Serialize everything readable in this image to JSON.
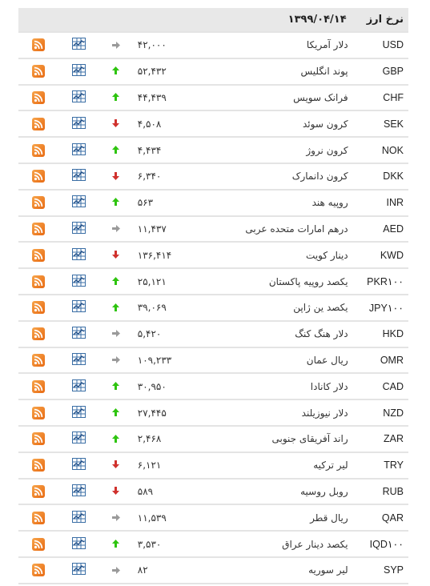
{
  "header": {
    "title": "نرخ ارز",
    "date": "۱۳۹۹/۰۴/۱۴"
  },
  "colors": {
    "up": "#2ec40f",
    "down": "#d0312d",
    "flat": "#9a9a9a",
    "rss": "#f08a2c",
    "chart": "#3a6ea5",
    "header_bg": "#e8e8e8"
  },
  "rows": [
    {
      "code": "USD",
      "name": "دلار آمریکا",
      "value": "۴۲,۰۰۰",
      "trend": "flat"
    },
    {
      "code": "GBP",
      "name": "پوند انگلیس",
      "value": "۵۲,۴۳۲",
      "trend": "up"
    },
    {
      "code": "CHF",
      "name": "فرانک سویس",
      "value": "۴۴,۴۳۹",
      "trend": "up"
    },
    {
      "code": "SEK",
      "name": "کرون سوئد",
      "value": "۴,۵۰۸",
      "trend": "down"
    },
    {
      "code": "NOK",
      "name": "کرون نروژ",
      "value": "۴,۴۳۴",
      "trend": "up"
    },
    {
      "code": "DKK",
      "name": "کرون دانمارک",
      "value": "۶,۳۴۰",
      "trend": "down"
    },
    {
      "code": "INR",
      "name": "روپیه هند",
      "value": "۵۶۳",
      "trend": "up"
    },
    {
      "code": "AED",
      "name": "درهم امارات متحده عربی",
      "value": "۱۱,۴۳۷",
      "trend": "flat"
    },
    {
      "code": "KWD",
      "name": "دینار کویت",
      "value": "۱۳۶,۴۱۴",
      "trend": "down"
    },
    {
      "code": "PKR۱۰۰",
      "name": "یکصد روپیه پاکستان",
      "value": "۲۵,۱۲۱",
      "trend": "up"
    },
    {
      "code": "JPY۱۰۰",
      "name": "یکصد ین ژاپن",
      "value": "۳۹,۰۶۹",
      "trend": "up"
    },
    {
      "code": "HKD",
      "name": "دلار هنگ کنگ",
      "value": "۵,۴۲۰",
      "trend": "flat"
    },
    {
      "code": "OMR",
      "name": "ریال عمان",
      "value": "۱۰۹,۲۳۳",
      "trend": "flat"
    },
    {
      "code": "CAD",
      "name": "دلار کانادا",
      "value": "۳۰,۹۵۰",
      "trend": "up"
    },
    {
      "code": "NZD",
      "name": "دلار نیوزیلند",
      "value": "۲۷,۴۴۵",
      "trend": "up"
    },
    {
      "code": "ZAR",
      "name": "راند آفریقای جنوبی",
      "value": "۲,۴۶۸",
      "trend": "up"
    },
    {
      "code": "TRY",
      "name": "لیر ترکیه",
      "value": "۶,۱۲۱",
      "trend": "down"
    },
    {
      "code": "RUB",
      "name": "روبل روسیه",
      "value": "۵۸۹",
      "trend": "down"
    },
    {
      "code": "QAR",
      "name": "ریال قطر",
      "value": "۱۱,۵۳۹",
      "trend": "flat"
    },
    {
      "code": "IQD۱۰۰",
      "name": "یکصد دینار عراق",
      "value": "۳,۵۳۰",
      "trend": "up"
    },
    {
      "code": "SYP",
      "name": "لیر سوریه",
      "value": "۸۲",
      "trend": "flat"
    }
  ]
}
